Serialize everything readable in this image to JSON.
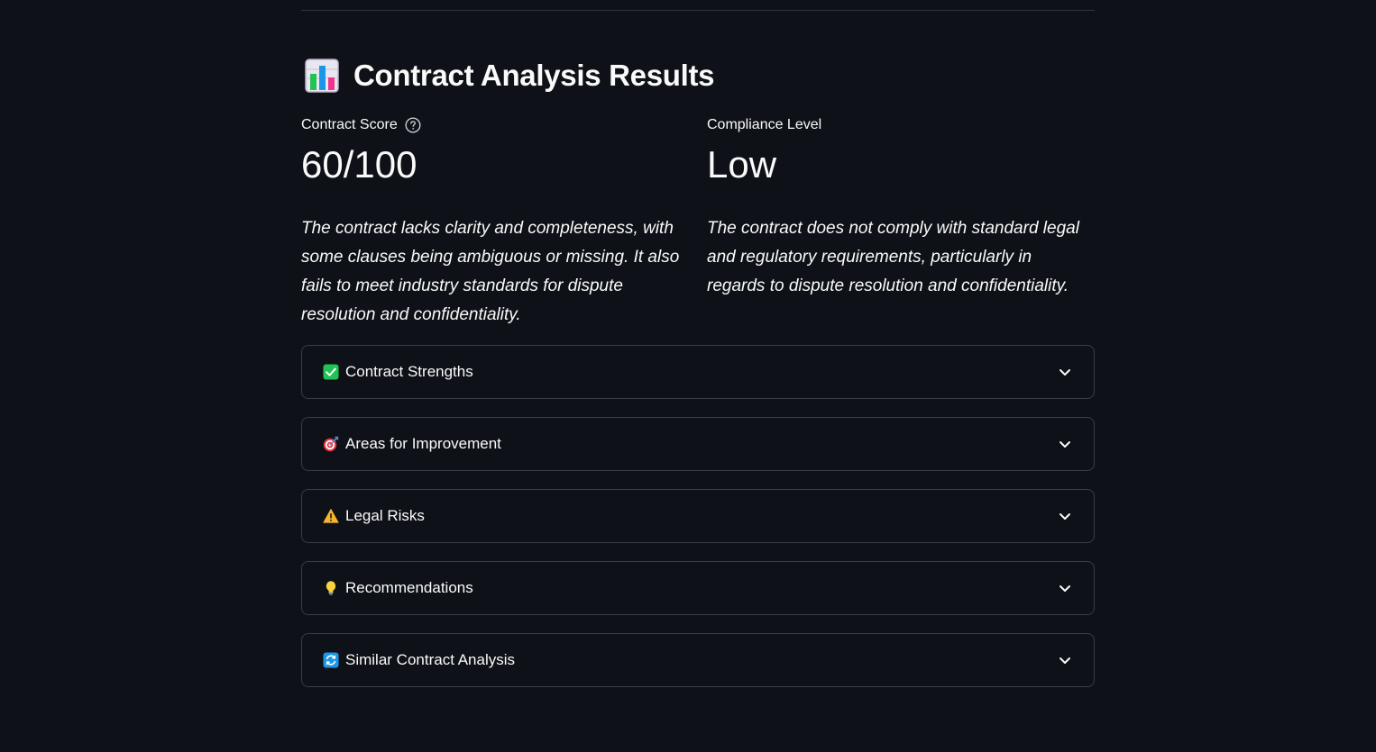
{
  "header": {
    "title": "Contract Analysis Results",
    "icon": "bar-chart-icon"
  },
  "metrics": [
    {
      "label": "Contract Score",
      "value": "60/100",
      "has_help": true,
      "description": "The contract lacks clarity and completeness, with some clauses being ambiguous or missing. It also fails to meet industry standards for dispute resolution and confidentiality."
    },
    {
      "label": "Compliance Level",
      "value": "Low",
      "has_help": false,
      "description": "The contract does not comply with standard legal and regulatory requirements, particularly in regards to dispute resolution and confidentiality."
    }
  ],
  "expanders": [
    {
      "label": "Contract Strengths",
      "icon": "check-mark-icon"
    },
    {
      "label": "Areas for Improvement",
      "icon": "target-icon"
    },
    {
      "label": "Legal Risks",
      "icon": "warning-icon"
    },
    {
      "label": "Recommendations",
      "icon": "lightbulb-icon"
    },
    {
      "label": "Similar Contract Analysis",
      "icon": "refresh-icon"
    }
  ],
  "colors": {
    "background": "#0e1117",
    "text": "#fafafa",
    "border": "#3a3d4a",
    "check_green": "#21c354",
    "warning_yellow": "#f7b52c",
    "refresh_blue": "#1c96e8"
  }
}
